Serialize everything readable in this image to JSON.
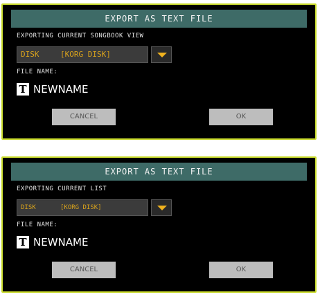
{
  "dialogs": [
    {
      "title": "EXPORT AS TEXT FILE",
      "subtitle": "EXPORTING CURRENT SONGBOOK VIEW",
      "device": "DISK",
      "volume": "[KORG DISK]",
      "file_name_label": "FILE NAME:",
      "text_icon": "T",
      "file_name": "NEWNAME",
      "cancel_label": "CANCEL",
      "ok_label": "OK"
    },
    {
      "title": "EXPORT AS TEXT FILE",
      "subtitle": "EXPORTING CURRENT LIST",
      "device": "DISK",
      "volume": "[KORG DISK]",
      "file_name_label": "FILE NAME:",
      "text_icon": "T",
      "file_name": "NEWNAME",
      "cancel_label": "CANCEL",
      "ok_label": "OK"
    }
  ],
  "colors": {
    "border": "#c9db2a",
    "title_bar": "#3e6b67",
    "select_text": "#d8a21c",
    "dropdown_arrow": "#f0b21e",
    "button_bg": "#bdbdbd"
  },
  "icons": {
    "dropdown": "chevron-down-icon",
    "text_edit": "text-edit-icon"
  }
}
